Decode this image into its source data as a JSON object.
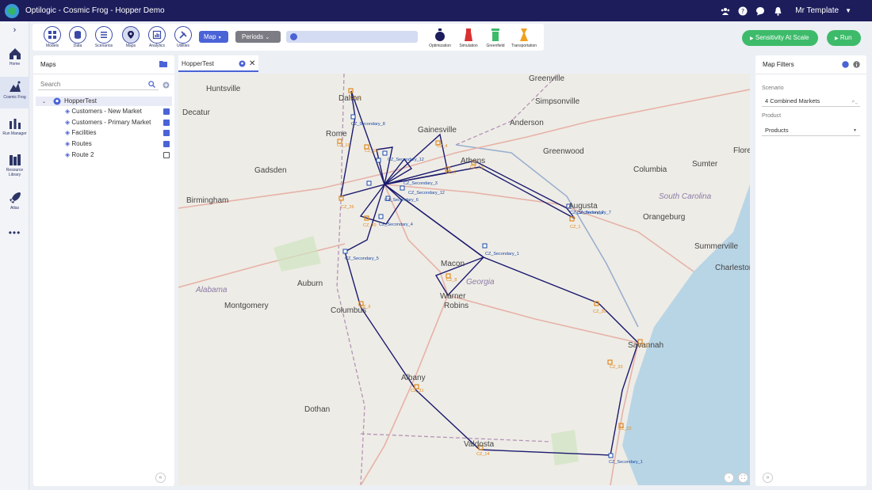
{
  "app": {
    "title": "Optilogic - Cosmic Frog - Hopper Demo",
    "user": "Mr Template"
  },
  "topbar_icons": [
    "team-icon",
    "help-icon",
    "chat-icon",
    "bell-icon"
  ],
  "rail": [
    {
      "label": "Home",
      "icon": "home-icon"
    },
    {
      "label": "Cosmic Frog",
      "icon": "frog-icon",
      "active": true
    },
    {
      "label": "Run Manager",
      "icon": "run-manager-icon"
    },
    {
      "label": "Resource Library",
      "icon": "library-icon"
    },
    {
      "label": "Atlas",
      "icon": "rocket-icon"
    }
  ],
  "toolbar": {
    "buttons": [
      "Models",
      "Data",
      "Scenarios",
      "Maps",
      "Analytics",
      "Utilities"
    ],
    "active": "Maps",
    "map_select": "Map",
    "periods_select": "Periods",
    "run_types": [
      "Optimization",
      "Simulation",
      "Greenfield",
      "Transportation"
    ]
  },
  "actions": {
    "sensitivity": "Sensitivity At Scale",
    "run": "Run"
  },
  "maps_panel": {
    "title": "Maps",
    "search_placeholder": "Search",
    "tree_root": "HopperTest",
    "layers": [
      {
        "label": "Customers - New Market",
        "checked": true
      },
      {
        "label": "Customers - Primary Market",
        "checked": true
      },
      {
        "label": "Facilities",
        "checked": true
      },
      {
        "label": "Routes",
        "checked": true
      },
      {
        "label": "Route 2",
        "checked": false
      }
    ]
  },
  "map_tab": {
    "label": "HopperTest"
  },
  "filters": {
    "title": "Map Filters",
    "scenario_label": "Scenario",
    "scenario_value": "4 Combined Markets",
    "product_label": "Product",
    "product_value": "Products"
  },
  "colors": {
    "brand_navy": "#1d1d5c",
    "accent_blue": "#4a63d6",
    "green": "#3dbb6a",
    "route": "#1a1a6e",
    "customer": "#e08a1e"
  },
  "map_labels": {
    "cities": [
      "Huntsville",
      "Dalton",
      "Greenville",
      "Simpsonville",
      "Decatur",
      "Gainesville",
      "Anderson",
      "Rome",
      "Athens",
      "Greenwood",
      "Florence",
      "Gadsden",
      "Columbia",
      "Sumter",
      "Birmingham",
      "South Carolina",
      "Augusta",
      "Orangeburg",
      "Macon",
      "Georgia",
      "Summerville",
      "Charleston",
      "Auburn",
      "Warner Robins",
      "Alabama",
      "Montgomery",
      "Columbus",
      "Savannah",
      "Albany",
      "Dothan",
      "Valdosta"
    ],
    "secondary": [
      "CZ_Secondary_8",
      "CZ_Secondary_12",
      "CZ_Secondary_3",
      "CZ_Secondary_12",
      "CZ_Secondary_6",
      "CZ_Secondary_4",
      "CZ_Secondary_5",
      "CZ_Secondary_1",
      "CZ_Secondary_2",
      "CZ_Secondary_7",
      "CZ_Secondary_1"
    ],
    "customers": [
      "CZ_2",
      "CZ_16",
      "CZ_18",
      "CZ_4",
      "CZ_13",
      "CZ_6",
      "CZ_26",
      "CZ_20",
      "CZ_1",
      "CZ_8",
      "CZ_9",
      "CZ_30",
      "CZ_33",
      "CZ_31",
      "CZ_22",
      "CZ_14",
      "CZ_12"
    ]
  }
}
